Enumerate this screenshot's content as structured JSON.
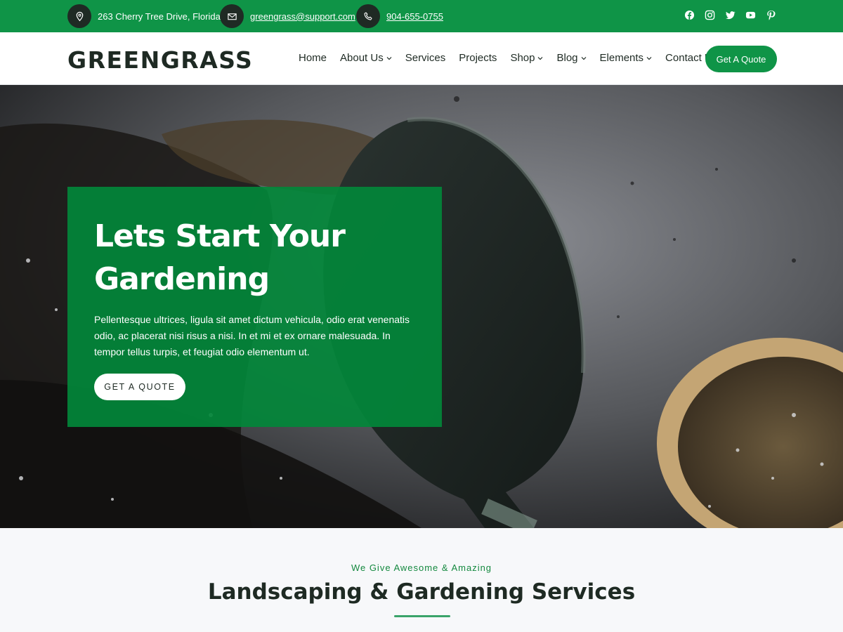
{
  "topbar": {
    "address": "263 Cherry Tree Drive, Florida.",
    "email": "greengrass@support.com",
    "phone": "904-655-0755",
    "icons": {
      "address": "map-pin-icon",
      "email": "envelope-icon",
      "phone": "phone-icon"
    },
    "socials": [
      "facebook-icon",
      "instagram-icon",
      "twitter-icon",
      "youtube-icon",
      "pinterest-icon"
    ]
  },
  "header": {
    "logo": "GREENGRASS",
    "nav": [
      {
        "label": "Home",
        "dropdown": false
      },
      {
        "label": "About Us",
        "dropdown": true
      },
      {
        "label": "Services",
        "dropdown": false
      },
      {
        "label": "Projects",
        "dropdown": false
      },
      {
        "label": "Shop",
        "dropdown": true
      },
      {
        "label": "Blog",
        "dropdown": true
      },
      {
        "label": "Elements",
        "dropdown": true
      },
      {
        "label": "Contact Us",
        "dropdown": false
      }
    ],
    "cta": "Get A Quote"
  },
  "hero": {
    "title_line1": "Lets Start Your",
    "title_line2": "Gardening",
    "text": "Pellentesque ultrices, ligula sit amet dictum vehicula, odio erat venenatis odio, ac placerat nisi risus a nisi. In et mi et ex ornare malesuada. In tempor tellus turpis, et feugiat odio elementum ut.",
    "button": "GET A QUOTE"
  },
  "services": {
    "subtitle": "We Give Awesome & Amazing",
    "title": "Landscaping & Gardening Services"
  },
  "colors": {
    "brand_green": "#0f9447",
    "dark": "#1e2a23",
    "overlay_green": "#02873a"
  }
}
